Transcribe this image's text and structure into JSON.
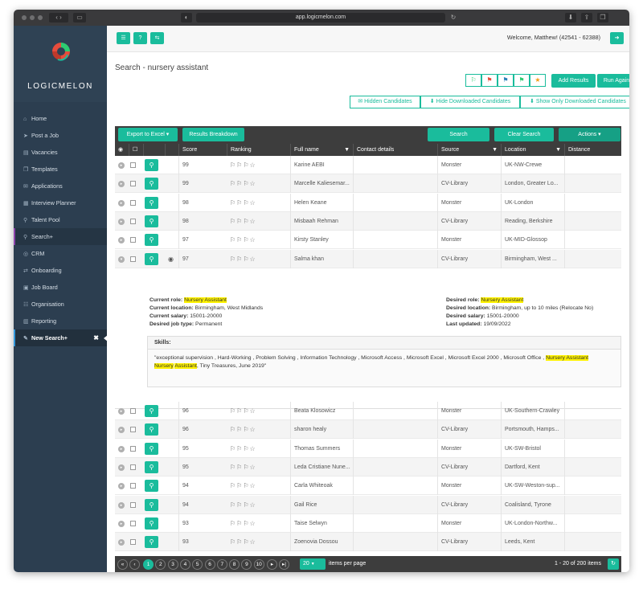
{
  "browser": {
    "url": "app.logicmelon.com"
  },
  "brand": {
    "name": "LOGICMELON",
    "accent": "#1abc9c",
    "sidebar_bg": "#2c3e50"
  },
  "sidebar": {
    "items": [
      {
        "label": "Home",
        "icon": "home-icon",
        "glyph": "⌂"
      },
      {
        "label": "Post a Job",
        "icon": "send-icon",
        "glyph": "➤"
      },
      {
        "label": "Vacancies",
        "icon": "list-icon",
        "glyph": "▤"
      },
      {
        "label": "Templates",
        "icon": "copy-icon",
        "glyph": "❐"
      },
      {
        "label": "Applications",
        "icon": "mail-icon",
        "glyph": "✉"
      },
      {
        "label": "Interview Planner",
        "icon": "calendar-icon",
        "glyph": "▦"
      },
      {
        "label": "Talent Pool",
        "icon": "search-icon",
        "glyph": "⚲"
      },
      {
        "label": "Search+",
        "icon": "search-plus-icon",
        "glyph": "⚲"
      },
      {
        "label": "CRM",
        "icon": "crm-icon",
        "glyph": "◎"
      },
      {
        "label": "Onboarding",
        "icon": "exchange-icon",
        "glyph": "⇄"
      },
      {
        "label": "Job Board",
        "icon": "board-icon",
        "glyph": "▣"
      },
      {
        "label": "Organisation",
        "icon": "users-icon",
        "glyph": "☷"
      },
      {
        "label": "Reporting",
        "icon": "chart-icon",
        "glyph": "▥"
      },
      {
        "label": "New Search+",
        "icon": "edit-icon",
        "glyph": "✎"
      }
    ],
    "close_glyph": "✖"
  },
  "header": {
    "welcome": "Welcome, Matthew! (42541 - 62388)"
  },
  "page": {
    "title": "Search - nursery assistant"
  },
  "actions": {
    "add_results": "Add Results",
    "run_again": "Run Again",
    "hidden_candidates": "✉ Hidden Candidates",
    "hide_downloaded": "⬇ Hide Downloaded Candidates",
    "show_only_downloaded": "⬇ Show Only Downloaded Candidates",
    "flag_colors": [
      "#2ecc71",
      "#e74c3c",
      "#2980b9",
      "#2ecc71",
      "#f39c12"
    ]
  },
  "toolbar": {
    "export": "Export to Excel ▾",
    "breakdown": "Results Breakdown",
    "search": "Search",
    "clear": "Clear Search",
    "actions": "Actions ▾"
  },
  "table": {
    "headers": {
      "score": "Score",
      "ranking": "Ranking",
      "name": "Full name",
      "contact": "Contact details",
      "source": "Source",
      "location": "Location",
      "distance": "Distance"
    },
    "ranking_glyphs": "⚐⚐⚐☆",
    "rows_top": [
      {
        "score": "99",
        "name": "Karine AEBI",
        "source": "Monster",
        "location": "UK-NW-Crewe"
      },
      {
        "score": "99",
        "name": "Marcelle Kaliesemar...",
        "source": "CV-Library",
        "location": "London, Greater Lo..."
      },
      {
        "score": "98",
        "name": "Helen Keane",
        "source": "Monster",
        "location": "UK-London"
      },
      {
        "score": "98",
        "name": "Misbaah Rehman",
        "source": "CV-Library",
        "location": "Reading, Berkshire"
      },
      {
        "score": "97",
        "name": "Kirsty Stanley",
        "source": "Monster",
        "location": "UK-MID-Glossop"
      },
      {
        "score": "97",
        "name": "Salma khan",
        "source": "CV-Library",
        "location": "Birmingham, West ..."
      }
    ],
    "rows_bottom": [
      {
        "score": "96",
        "name": "Beata Klosowicz",
        "source": "Monster",
        "location": "UK-Southern-Crawley"
      },
      {
        "score": "96",
        "name": "sharon healy",
        "source": "CV-Library",
        "location": "Portsmouth, Hamps..."
      },
      {
        "score": "95",
        "name": "Thomas Summers",
        "source": "Monster",
        "location": "UK-SW-Bristol"
      },
      {
        "score": "95",
        "name": "Leda Cristiane Nune...",
        "source": "CV-Library",
        "location": "Dartford, Kent"
      },
      {
        "score": "94",
        "name": "Carla Whiteoak",
        "source": "Monster",
        "location": "UK-SW-Weston-sup..."
      },
      {
        "score": "94",
        "name": "Gail Rice",
        "source": "CV-Library",
        "location": "Coalisland, Tyrone"
      },
      {
        "score": "93",
        "name": "Taise Selwyn",
        "source": "Monster",
        "location": "UK-London-Northw..."
      },
      {
        "score": "93",
        "name": "Zoenovia Dossou",
        "source": "CV-Library",
        "location": "Leeds, Kent"
      }
    ]
  },
  "detail": {
    "current_role_label": "Current role:",
    "current_role": "Nursery Assistant",
    "current_location_label": "Current location:",
    "current_location": "Birmingham, West Midlands",
    "current_salary_label": "Current salary:",
    "current_salary": "15001-20000",
    "desired_job_type_label": "Desired job type:",
    "desired_job_type": "Permanent",
    "desired_role_label": "Desired role:",
    "desired_role": "Nursery Assistant",
    "desired_location_label": "Desired location:",
    "desired_location": "Birmingham, up to 10 miles (Relocate No)",
    "desired_salary_label": "Desired salary:",
    "desired_salary": "15001-20000",
    "last_updated_label": "Last updated:",
    "last_updated": "19/09/2022",
    "skills_title": "Skills:",
    "skills_pre": "\"exceptional supervision , Hard-Working , Problem Solving , Information Technology , Microsoft Access , Microsoft Excel , Microsoft Excel 2000 , Microsoft Office ,",
    "skills_hl1": "Nursery Assistant",
    "skills_hl2a": "Nursery",
    "skills_hl2b": "Assistant",
    "skills_post": ", Tiny Treasures, June 2019\""
  },
  "pager": {
    "pages": [
      "1",
      "2",
      "3",
      "4",
      "5",
      "6",
      "7",
      "8",
      "9",
      "10"
    ],
    "per_page": "20",
    "per_page_label": "items per page",
    "summary": "1 - 20 of 200 items"
  }
}
